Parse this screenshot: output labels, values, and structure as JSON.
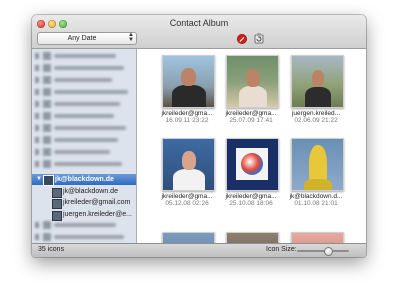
{
  "window": {
    "title": "Contact Album"
  },
  "toolbar": {
    "date_filter": {
      "value": "Any Date"
    },
    "stop_icon": "no-entry-icon",
    "refresh_icon": "refresh-icon"
  },
  "sidebar": {
    "selected": {
      "label": "jk@blackdown.de",
      "expanded": true
    },
    "subitems": [
      {
        "label": "jk@blackdown.de"
      },
      {
        "label": "jkreileder@gmail.com"
      },
      {
        "label": "juergen.kreileder@e..."
      }
    ]
  },
  "grid": {
    "items": [
      {
        "name": "jkreileder@gma...",
        "date": "16.09.11 23:22"
      },
      {
        "name": "jkreileder@gma...",
        "date": "25.07.09 17:41"
      },
      {
        "name": "juergen.kreiled...",
        "date": "02.06.09 21:22"
      },
      {
        "name": "jkreileder@gma...",
        "date": "05.12.08 02:26"
      },
      {
        "name": "jkreileder@gma...",
        "date": "25.10.08 18:06"
      },
      {
        "name": "jk@blackdown.d...",
        "date": "01.10.08 21:01"
      }
    ]
  },
  "status": {
    "count": "35 icons",
    "icon_size_label": "Icon Size:",
    "icon_size_level": 0.6
  }
}
